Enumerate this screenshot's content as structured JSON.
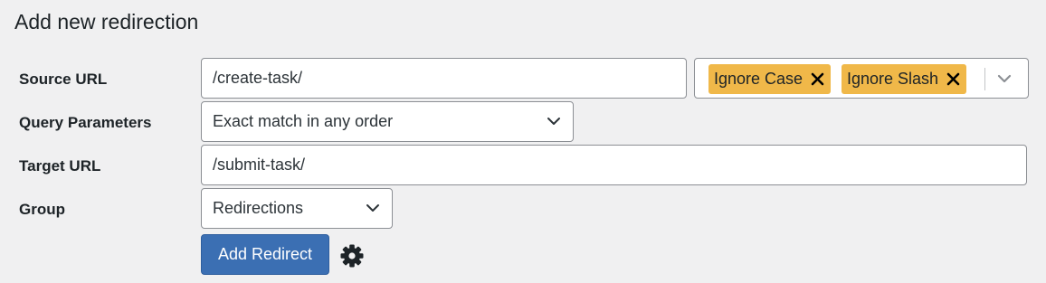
{
  "page": {
    "title": "Add new redirection"
  },
  "form": {
    "source_url": {
      "label": "Source URL",
      "value": "/create-task/"
    },
    "source_options": {
      "tags": [
        "Ignore Case",
        "Ignore Slash"
      ],
      "remove_icon": "close-icon",
      "dropdown_icon": "chevron-down-icon"
    },
    "query_parameters": {
      "label": "Query Parameters",
      "selected": "Exact match in any order"
    },
    "target_url": {
      "label": "Target URL",
      "value": "/submit-task/"
    },
    "group": {
      "label": "Group",
      "selected": "Redirections"
    },
    "submit": {
      "label": "Add Redirect"
    },
    "options_icon": "gear-icon"
  },
  "colors": {
    "background": "#f0f0f1",
    "primary_button": "#3b6fb3",
    "tag_background": "#f0b849",
    "input_border": "#8c8f94"
  }
}
